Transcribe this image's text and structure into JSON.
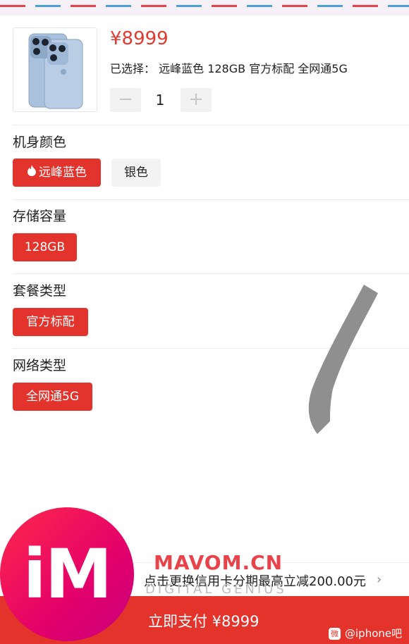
{
  "product": {
    "price": "¥8999",
    "selected_prefix": "已选择：",
    "selected_value": "远峰蓝色 128GB 官方标配 全网通5G",
    "quantity": "1",
    "minus_label": "−",
    "plus_label": "+"
  },
  "sections": {
    "color": {
      "title": "机身颜色",
      "options": [
        "远峰蓝色",
        "银色"
      ]
    },
    "storage": {
      "title": "存储容量",
      "options": [
        "128GB"
      ]
    },
    "package": {
      "title": "套餐类型",
      "options": [
        "官方标配"
      ]
    },
    "network": {
      "title": "网络类型",
      "options": [
        "全网通5G"
      ]
    }
  },
  "promo": {
    "text": "点击更换信用卡分期最高立减200.00元",
    "chevron": "›"
  },
  "pay": {
    "label": "立即支付 ¥8999"
  },
  "watermark": {
    "logo": "iM",
    "site": "MAVOM.CN",
    "tagline": "DIGITAL GENIUS",
    "weibo": "@iphone吧",
    "weibo_icon": "微"
  },
  "colors": {
    "accent": "#e2332c",
    "paybar": "#e3332b",
    "option_inactive_bg": "#f3f3f3",
    "phone_blue": "#9fb9d6"
  },
  "icons": {
    "flame": "flame-icon",
    "chevron": "chevron-right-icon"
  }
}
